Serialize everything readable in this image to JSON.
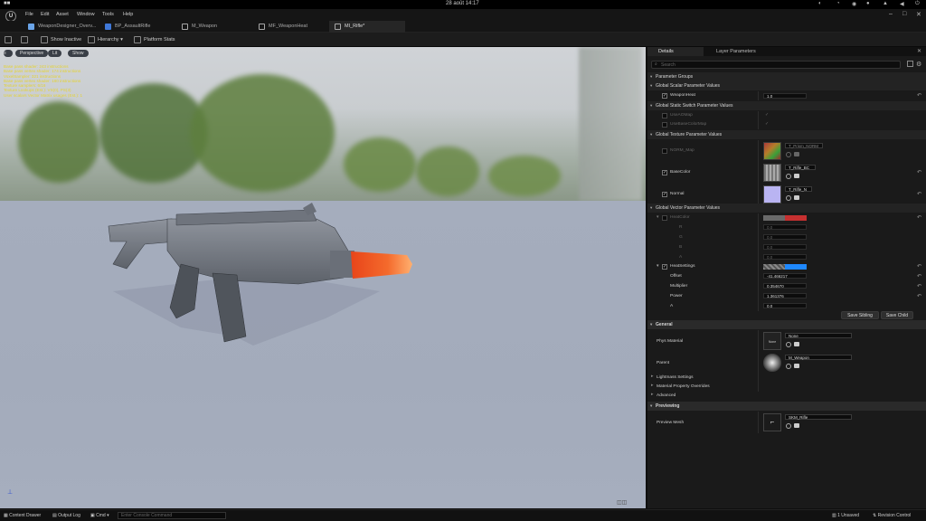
{
  "system": {
    "activities": "Activities",
    "clock": "28 août  14:17"
  },
  "menu": {
    "items": [
      "File",
      "Edit",
      "Asset",
      "Window",
      "Tools",
      "Help"
    ]
  },
  "tabs": [
    {
      "label": "WeaponDesigner_Overv...",
      "color": "#6aa4e8"
    },
    {
      "label": "BP_AssaultRifle",
      "color": "#3f78d8"
    },
    {
      "label": "M_Weapon",
      "color": "#a8a8a8"
    },
    {
      "label": "MF_WeaponHeat",
      "color": "#a8a8a8"
    },
    {
      "label": "MI_Rifle*",
      "color": "#a8a8a8"
    }
  ],
  "toolbar": {
    "show_inactive": "Show Inactive",
    "hierarchy": "Hierarchy",
    "platform_stats": "Platform Stats"
  },
  "viewport": {
    "perspective": "Perspective",
    "lit": "Lit",
    "show": "Show",
    "stats": [
      "Base pass shader: 243 instructions",
      "Base pass vertex shader: 174 instructions",
      "VoxelSampler: 321 instructions",
      "Base pass vertex shader: 180 instructions",
      "Texture samplers: 6/16",
      "Texture Lookups (Est.): VS(0), PS(3)",
      "User scalars Vector Matrix usages (Est.): 1"
    ]
  },
  "panel": {
    "tab_details": "Details",
    "tab_layer": "Layer Parameters",
    "search_placeholder": "Search",
    "parameter_groups": "Parameter Groups",
    "scalar_header": "Global Scalar Parameter Values",
    "weapon_heat_label": "WeaponHeat",
    "weapon_heat_value": "1.0",
    "switch_header": "Global Static Switch Parameter Values",
    "switch_1": "UseAOMap",
    "switch_2": "UseBaseColorMap",
    "texture_header": "Global Texture Parameter Values",
    "tex_orm": "NORM_Map",
    "tex_orm_value": "T_Prism_NORM",
    "tex_base": "BaseColor",
    "tex_base_value": "T_Rifle_BC",
    "tex_normal": "Normal",
    "tex_normal_value": "T_Rifle_N",
    "vector_header": "Global Vector Parameter Values",
    "heat_color": "HeatColor",
    "heat_r": "R",
    "heat_g": "G",
    "heat_b": "B",
    "heat_a": "A",
    "heat_r_value": "0.0",
    "heat_g_value": "0.0",
    "heat_b_value": "0.0",
    "heat_a_value": "0.0",
    "heat_settings": "HeatSettings",
    "offset_label": "Offset",
    "offset_value": "-41.466217",
    "multiplier_label": "Multiplier",
    "multiplier_value": "0.354670",
    "power_label": "Power",
    "power_value": "1.361376",
    "a_label": "A",
    "a_value": "0.0",
    "save_sibling": "Save Sibling",
    "save_child": "Save Child",
    "general": "General",
    "phys_material": "Phys Material",
    "phys_value": "None",
    "phys_thumb": "None",
    "parent": "Parent",
    "parent_value": "M_Weapon",
    "lightmass": "Lightmass Settings",
    "mat_overrides": "Material Property Overrides",
    "advanced": "Advanced",
    "previewing": "Previewing",
    "preview_mesh": "Preview Mesh",
    "preview_value": "SKM_Rifle"
  },
  "bottom": {
    "content_drawer": "Content Drawer",
    "output_log": "Output Log",
    "cmd": "Cmd",
    "console": "Enter Console Command",
    "unsaved": "1 Unsaved",
    "revision": "Revision Control"
  }
}
